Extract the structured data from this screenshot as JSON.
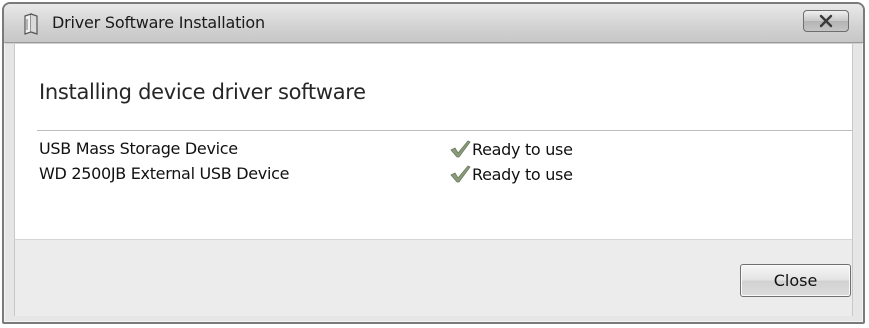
{
  "window": {
    "title": "Driver Software Installation",
    "title_icon": "driver-installer-icon",
    "close_icon": "close-icon"
  },
  "main": {
    "heading": "Installing device driver software",
    "devices": [
      {
        "name": "USB Mass Storage Device",
        "status": "Ready to use",
        "status_icon": "checkmark-icon"
      },
      {
        "name": "WD 2500JB External USB Device",
        "status": "Ready to use",
        "status_icon": "checkmark-icon"
      }
    ]
  },
  "footer": {
    "close_label": "Close"
  },
  "colors": {
    "checkmark": "#7a8a6a",
    "titlebar": "#d2d2d2",
    "content_bg": "#ffffff",
    "footer_bg": "#ececec"
  }
}
